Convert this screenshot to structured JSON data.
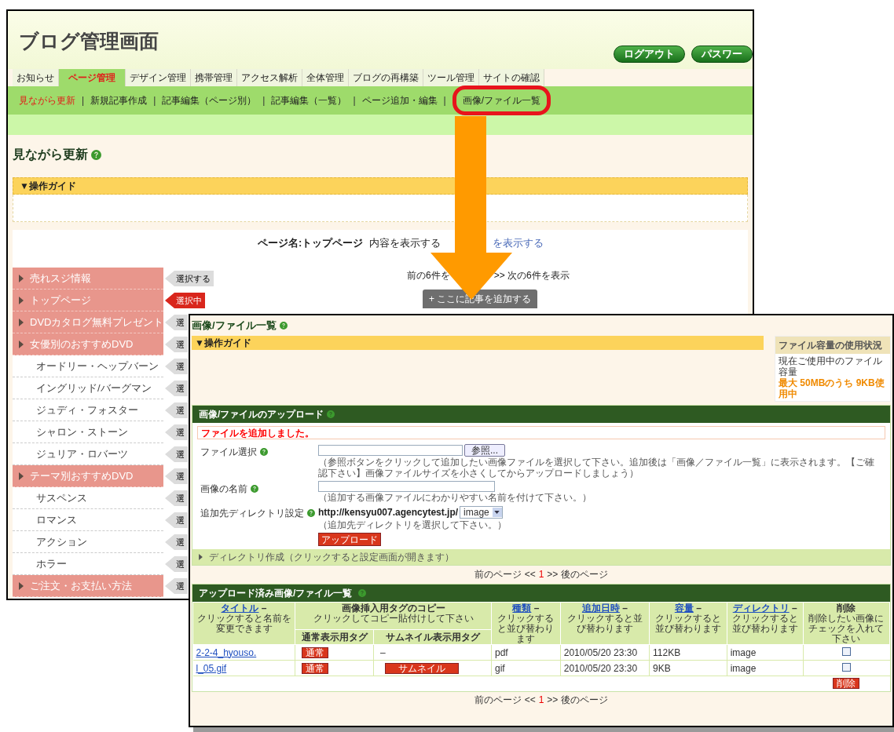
{
  "back_window": {
    "title": "ブログ管理画面",
    "header_buttons": [
      "ログアウト",
      "パスワー"
    ],
    "tabs": [
      {
        "label": "お知らせ",
        "selected": false
      },
      {
        "label": "ページ管理",
        "selected": true
      },
      {
        "label": "デザイン管理",
        "selected": false
      },
      {
        "label": "携帯管理",
        "selected": false
      },
      {
        "label": "アクセス解析",
        "selected": false
      },
      {
        "label": "全体管理",
        "selected": false
      },
      {
        "label": "ブログの再構築",
        "selected": false
      },
      {
        "label": "ツール管理",
        "selected": false
      },
      {
        "label": "サイトの確認",
        "selected": false
      }
    ],
    "subnav_separator": "|",
    "subnav": [
      {
        "label": "見ながら更新",
        "selected": true,
        "highlighted": false
      },
      {
        "label": "新規記事作成",
        "selected": false,
        "highlighted": false
      },
      {
        "label": "記事編集（ページ別）",
        "selected": false,
        "highlighted": false
      },
      {
        "label": "記事編集（一覧）",
        "selected": false,
        "highlighted": false
      },
      {
        "label": "ページ追加・編集",
        "selected": false,
        "highlighted": false
      },
      {
        "label": "画像/ファイル一覧",
        "selected": false,
        "highlighted": true
      }
    ],
    "section_title": "見ながら更新",
    "guide": "▼操作ガイド",
    "page_name": "ページ名:トップページ",
    "show_content": "内容を表示する",
    "show_other": "を表示する",
    "sidebar": [
      {
        "label": "売れスジ情報",
        "button": "選択する",
        "selected": false
      },
      {
        "label": "トップページ",
        "button": "選択中",
        "selected": true
      },
      {
        "label": "DVDカタログ無料プレゼント",
        "button": "選",
        "selected": false
      },
      {
        "label": "女優別のおすすめDVD",
        "button": "選",
        "selected": false,
        "children": [
          {
            "label": "オードリー・ヘップバーン",
            "button": "選",
            "selected": false
          },
          {
            "label": "イングリッド/バーグマン",
            "button": "選",
            "selected": false
          },
          {
            "label": "ジュディ・フォスター",
            "button": "選",
            "selected": false
          },
          {
            "label": "シャロン・ストーン",
            "button": "選",
            "selected": false
          },
          {
            "label": "ジュリア・ロバーツ",
            "button": "選",
            "selected": false
          }
        ]
      },
      {
        "label": "テーマ別おすすめDVD",
        "button": "選",
        "selected": false,
        "children": [
          {
            "label": "サスペンス",
            "button": "選",
            "selected": false
          },
          {
            "label": "ロマンス",
            "button": "選",
            "selected": false
          },
          {
            "label": "アクション",
            "button": "選",
            "selected": false
          },
          {
            "label": "ホラー",
            "button": "選",
            "selected": false
          }
        ]
      },
      {
        "label": "ご注文・お支払い方法",
        "button": "選",
        "selected": false
      }
    ],
    "pager": {
      "prev": "前の6件を",
      "next": ">> 次の6件を表示"
    },
    "add_button": "+ ここに記事を追加する"
  },
  "front_window": {
    "title": "画像/ファイル一覧",
    "guide": "▼操作ガイド",
    "usage": {
      "title": "ファイル容量の使用状況",
      "text": "現在ご使用中のファイル容量",
      "value": "最大 50MBのうち 9KB使用中"
    },
    "upload": {
      "title": "画像/ファイルのアップロード",
      "message": "ファイルを追加しました。",
      "fields": [
        {
          "kind": "file",
          "label": "ファイル選択",
          "button": "参照...",
          "hint": "（参照ボタンをクリックして追加したい画像ファイルを選択して下さい。追加後は「画像／ファイル一覧」に表示されます。【ご確認下さい】画像ファイルサイズを小さくしてからアップロードしましょう）"
        },
        {
          "kind": "text",
          "label": "画像の名前",
          "hint": "（追加する画像ファイルにわかりやすい名前を付けて下さい。）"
        },
        {
          "kind": "select",
          "label": "追加先ディレクトリ設定",
          "prefix": "http://kensyu007.agencytest.jp/",
          "value": "image",
          "hint": "（追加先ディレクトリを選択して下さい。）"
        }
      ],
      "submit": "アップロード",
      "directory_bar": "ディレクトリ作成（クリックすると設定画面が開きます）"
    },
    "pager": {
      "prev": "前のページ <<",
      "current": "1",
      "next": ">> 後のページ"
    },
    "files": {
      "title": "アップロード済み画像/ファイル一覧",
      "columns": [
        {
          "kind": "link",
          "label": "タイトル",
          "mark": "–",
          "note": "クリックすると名前を変更できます"
        },
        {
          "kind": "group",
          "label": "画像挿入用タグのコピー",
          "note": "クリックしてコピー貼付けして下さい"
        },
        {
          "kind": "link",
          "label": "種類",
          "mark": "–",
          "note": "クリックすると並び替わります"
        },
        {
          "kind": "link",
          "label": "追加日時",
          "mark": "–",
          "note": "クリックすると並び替わります"
        },
        {
          "kind": "link",
          "label": "容量",
          "mark": "–",
          "note": "クリックすると並び替わります"
        },
        {
          "kind": "link",
          "label": "ディレクトリ",
          "mark": "–",
          "note": "クリックすると並び替わります"
        },
        {
          "kind": "plain",
          "label": "削除",
          "note": "削除したい画像にチェックを入れて下さい"
        }
      ],
      "tag_subcolumns": [
        "通常表示用タグ",
        "サムネイル表示用タグ"
      ],
      "rows": [
        {
          "title": "2-2-4_hyouso.",
          "normal_tag": "通常",
          "thumb": {
            "kind": "text",
            "text": "–"
          },
          "type": "pdf",
          "date": "2010/05/20 23:30",
          "size": "112KB",
          "dir": "image",
          "checked": false
        },
        {
          "title": "l_05.gif",
          "normal_tag": "通常",
          "thumb": {
            "kind": "button",
            "text": "サムネイル"
          },
          "type": "gif",
          "date": "2010/05/20 23:30",
          "size": "9KB",
          "dir": "image",
          "checked": false
        }
      ],
      "delete_button": "削除"
    },
    "pager2": {
      "prev": "前のページ <<",
      "current": "1",
      "next": ">> 後のページ"
    }
  }
}
